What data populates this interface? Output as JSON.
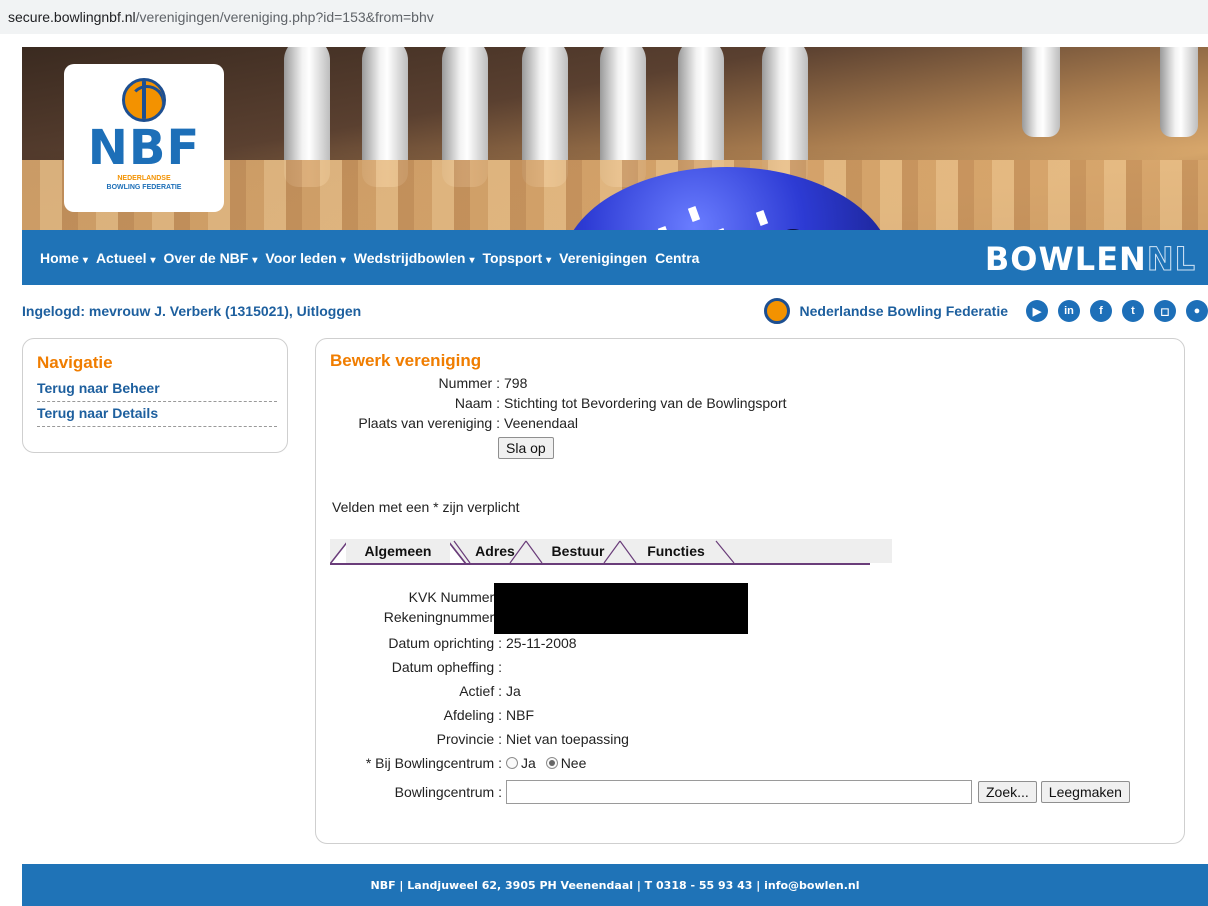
{
  "browser": {
    "url_host": "secure.bowlingnbf.nl",
    "url_path": "/verenigingen/vereniging.php?id=153&from=bhv"
  },
  "logo": {
    "text": "NBF",
    "sub_line1": "NEDERLANDSE",
    "sub_line2": "BOWLING FEDERATIE"
  },
  "nav": {
    "items": [
      {
        "label": "Home",
        "dropdown": true
      },
      {
        "label": "Actueel",
        "dropdown": true
      },
      {
        "label": "Over de NBF",
        "dropdown": true
      },
      {
        "label": "Voor leden",
        "dropdown": true
      },
      {
        "label": "Wedstrijdbowlen",
        "dropdown": true
      },
      {
        "label": "Topsport",
        "dropdown": true
      },
      {
        "label": "Verenigingen",
        "dropdown": false
      },
      {
        "label": "Centra",
        "dropdown": false
      }
    ],
    "brand_main": "BOWLEN",
    "brand_suffix": "NL"
  },
  "userbar": {
    "logged_in": "Ingelogd: mevrouw J. Verberk (1315021),",
    "logout": "Uitloggen",
    "federation": "Nederlandse Bowling Federatie",
    "social_icons": [
      "youtube-icon",
      "linkedin-icon",
      "facebook-icon",
      "twitter-icon",
      "instagram-icon",
      "bowling-icon"
    ]
  },
  "sidebar": {
    "title": "Navigatie",
    "links": [
      "Terug naar Beheer",
      "Terug naar Details"
    ]
  },
  "main": {
    "title": "Bewerk vereniging",
    "fields": [
      {
        "label": "Nummer :",
        "value": "798"
      },
      {
        "label": "Naam :",
        "value": "Stichting tot Bevordering van de Bowlingsport"
      },
      {
        "label": "Plaats van vereniging :",
        "value": "Veenendaal"
      }
    ],
    "save_label": "Sla op",
    "required_note": "Velden met een * zijn verplicht",
    "tabs": [
      "Algemeen",
      "Adres",
      "Bestuur",
      "Functies"
    ],
    "active_tab": "Algemeen",
    "general": {
      "kvk_label": "KVK Nummer :",
      "rekening_label": "Rekeningnummer :",
      "oprichting_label": "Datum oprichting :",
      "oprichting_value": "25-11-2008",
      "opheffing_label": "Datum opheffing :",
      "opheffing_value": "",
      "actief_label": "Actief :",
      "actief_value": "Ja",
      "afdeling_label": "Afdeling :",
      "afdeling_value": "NBF",
      "provincie_label": "Provincie :",
      "provincie_value": "Niet van toepassing",
      "bij_centrum_label": "* Bij Bowlingcentrum :",
      "radio_ja": "Ja",
      "radio_nee": "Nee",
      "radio_selected": "Nee",
      "centrum_label": "Bowlingcentrum :",
      "centrum_value": "",
      "zoek_label": "Zoek...",
      "leeg_label": "Leegmaken"
    }
  },
  "footer": {
    "text": "NBF  |  Landjuweel 62, 3905 PH Veenendaal  |  T 0318 - 55 93 43  |  info@bowlen.nl"
  }
}
